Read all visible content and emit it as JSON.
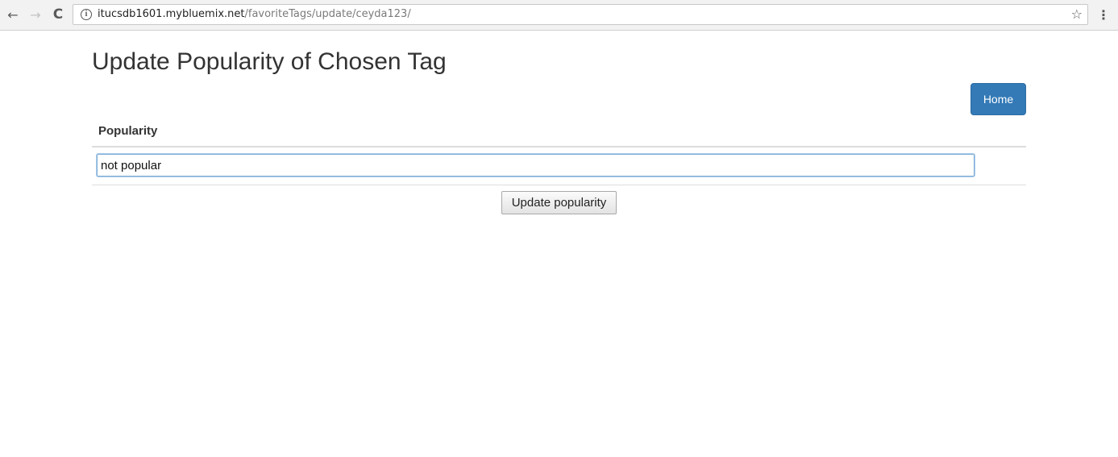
{
  "browser": {
    "back_icon": "←",
    "forward_icon": "→",
    "reload_icon": "C",
    "info_icon": "i",
    "url_host": "itucsdb1601.mybluemix.net",
    "url_path": "/favoriteTags/update/ceyda123/",
    "star_icon": "☆",
    "menu_icon": "⋮"
  },
  "page": {
    "title": "Update Popularity of Chosen Tag",
    "home_label": "Home",
    "table_header": "Popularity",
    "popularity_value": "not popular",
    "submit_label": "Update popularity"
  },
  "colors": {
    "primary_button": "#337ab7",
    "text": "#333333"
  }
}
